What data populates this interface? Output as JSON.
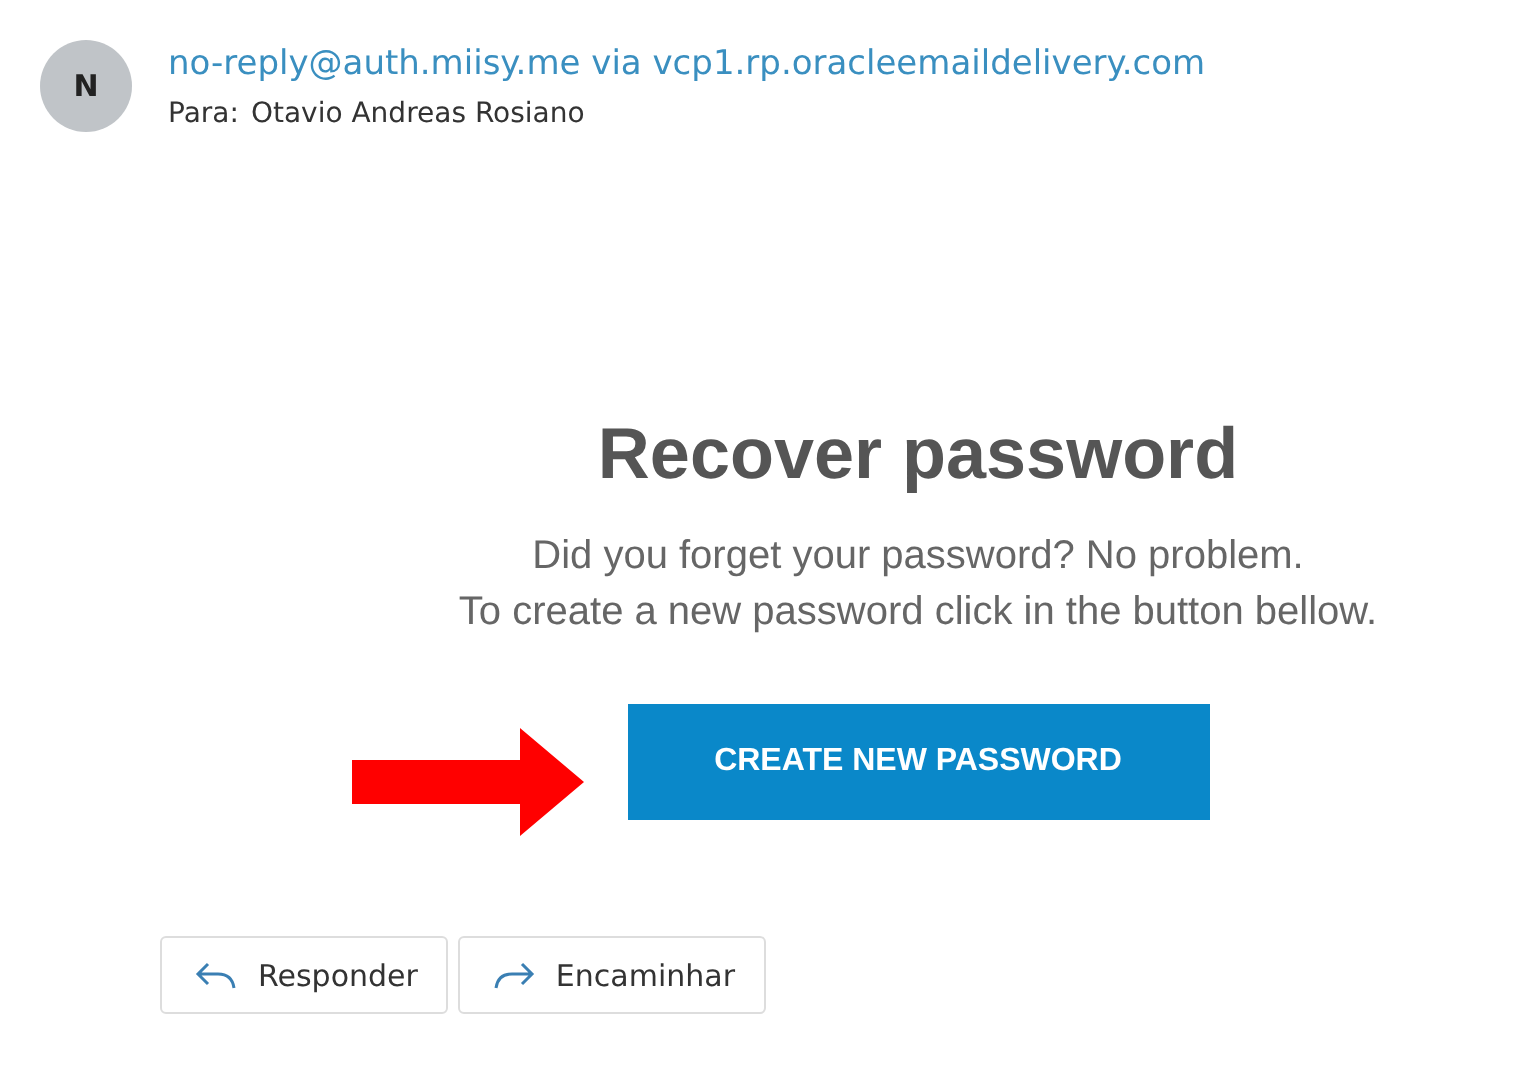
{
  "header": {
    "avatar_initial": "N",
    "sender": "no-reply@auth.miisy.me via vcp1.rp.oracleemaildelivery.com",
    "to_label": "Para:",
    "to_name": "Otavio Andreas Rosiano"
  },
  "body": {
    "title": "Recover password",
    "lines": [
      "Did you forget your password? No problem.",
      "To create a new password click in the button bellow."
    ],
    "button": "CREATE NEW PASSWORD"
  },
  "actions": [
    {
      "kind": "reply",
      "label": "Responder"
    },
    {
      "kind": "forward",
      "label": "Encaminhar"
    }
  ]
}
